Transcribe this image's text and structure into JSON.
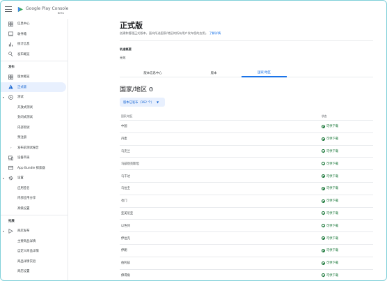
{
  "app": {
    "brand": "Google Play Console",
    "beta": "BETA"
  },
  "sidebar": {
    "top_items": [
      {
        "label": "信息中心",
        "icon": "dashboard-icon"
      },
      {
        "label": "收件箱",
        "icon": "inbox-icon"
      },
      {
        "label": "统计信息",
        "icon": "bar-chart-icon"
      },
      {
        "label": "发布概览",
        "icon": "publishing-icon"
      }
    ],
    "release_section": "发布",
    "release_items": [
      {
        "label": "版本概览",
        "icon": "dashboard-icon",
        "type": "item"
      },
      {
        "label": "正式版",
        "icon": "warning-icon",
        "type": "item",
        "active": true
      },
      {
        "label": "测试",
        "icon": "play-circle-icon",
        "type": "group"
      },
      {
        "label": "开放式测试",
        "type": "sub"
      },
      {
        "label": "封闭式测试",
        "type": "sub"
      },
      {
        "label": "内部测试",
        "type": "sub"
      },
      {
        "label": "预注册",
        "type": "sub"
      },
      {
        "label": "发布前测试报告",
        "type": "sub-caret"
      },
      {
        "label": "设备目录",
        "icon": "devices-icon",
        "type": "item"
      },
      {
        "label": "App Bundle 探索器",
        "icon": "bundle-icon",
        "type": "item"
      },
      {
        "label": "设置",
        "icon": "gear-icon",
        "type": "group"
      },
      {
        "label": "应用签名",
        "type": "sub"
      },
      {
        "label": "内部应用分享",
        "type": "sub"
      },
      {
        "label": "高级设置",
        "type": "sub"
      }
    ],
    "grow_section": "拓展",
    "grow_items": [
      {
        "label": "商店发布",
        "icon": "store-icon",
        "type": "group"
      },
      {
        "label": "主要商品详情",
        "type": "sub"
      },
      {
        "label": "自定义商品详情",
        "type": "sub"
      },
      {
        "label": "商品详情实验",
        "type": "sub"
      },
      {
        "label": "商店设置",
        "type": "sub"
      }
    ]
  },
  "main": {
    "title": "正式版",
    "subtitle": "创建和管理正式版本，面向所选国家/地区的所有用户发布您的应用。",
    "learn_more": "了解详情",
    "summary_label": "轨道概要",
    "summary_value": "无效",
    "tabs": [
      "版本信息中心",
      "版本",
      "国家/地区"
    ],
    "active_tab": 2,
    "section_title": "国家/地区",
    "chip_label": "版本已发布（162 个）",
    "table": {
      "headers": [
        "国家/地区",
        "状态"
      ],
      "status_text": "可供下载",
      "rows": [
        "中国",
        "丹麦",
        "乌克兰",
        "乌兹别克斯坦",
        "乌干达",
        "乌拉圭",
        "也门",
        "亚美尼亚",
        "以色列",
        "伊拉克",
        "伊朗",
        "伯利兹",
        "佛得角"
      ]
    }
  },
  "colors": {
    "accent": "#1a73e8",
    "active_bg": "#e8f0fe",
    "success": "#137333"
  }
}
